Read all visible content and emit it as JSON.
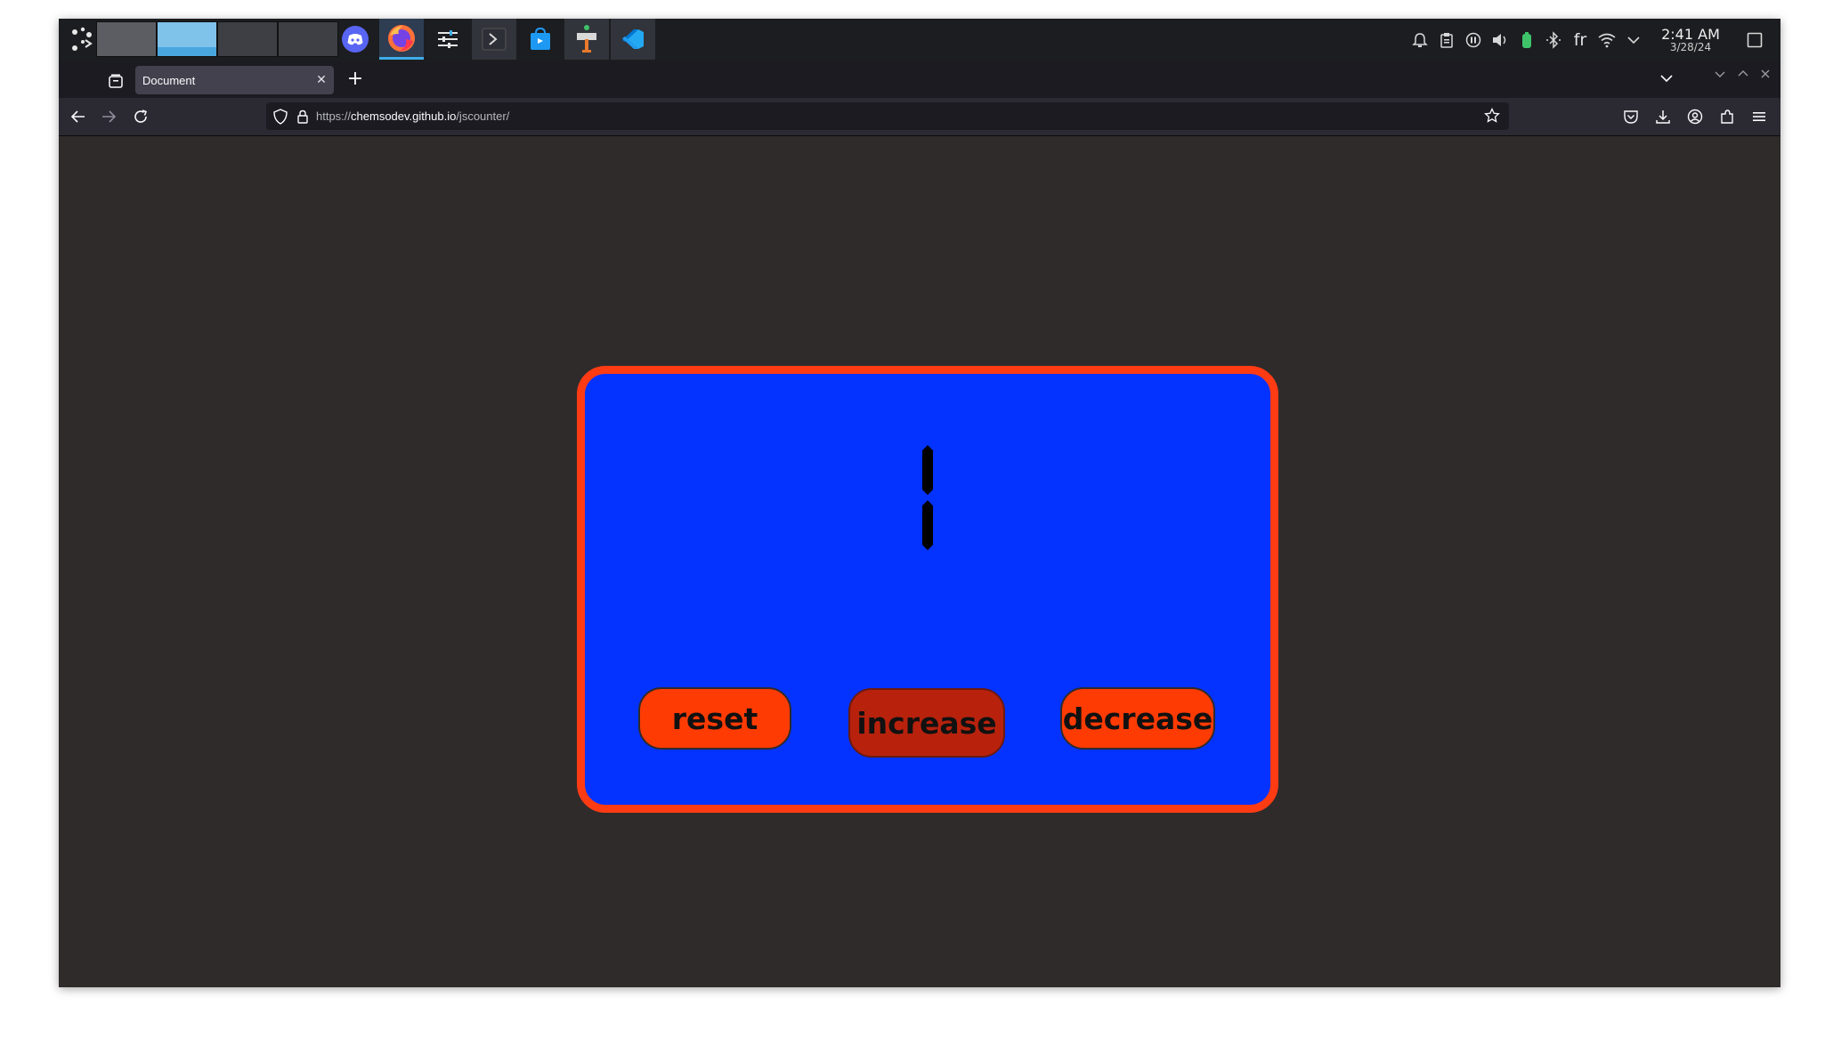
{
  "taskbar": {
    "pager_desktops": [
      "desktop-1",
      "desktop-2",
      "desktop-3",
      "desktop-4"
    ],
    "tasks": [
      {
        "name": "discord",
        "icon": "discord-icon"
      },
      {
        "name": "firefox",
        "icon": "firefox-icon",
        "active": true
      },
      {
        "name": "settings",
        "icon": "settings-sliders-icon"
      },
      {
        "name": "terminal",
        "icon": "terminal-icon"
      },
      {
        "name": "store",
        "icon": "store-bag-icon"
      },
      {
        "name": "update-manager",
        "icon": "package-icon"
      },
      {
        "name": "vscode",
        "icon": "vscode-icon"
      }
    ],
    "tray": {
      "language": "fr",
      "time": "2:41 AM",
      "date": "3/28/24"
    }
  },
  "browser": {
    "tab_title": "Document",
    "url_scheme": "https://",
    "url_host": "chemsodev.github.io",
    "url_path": "/jscounter/"
  },
  "counter": {
    "value": 1,
    "buttons": {
      "reset": "reset",
      "increase": "increase",
      "decrease": "decrease"
    }
  },
  "colors": {
    "page_background": "#2f2b2b",
    "card_background": "#0433ff",
    "card_border": "#ff3b14",
    "button": "#ff3b04",
    "button_pressed": "#b8220d",
    "digit": "#000000"
  }
}
